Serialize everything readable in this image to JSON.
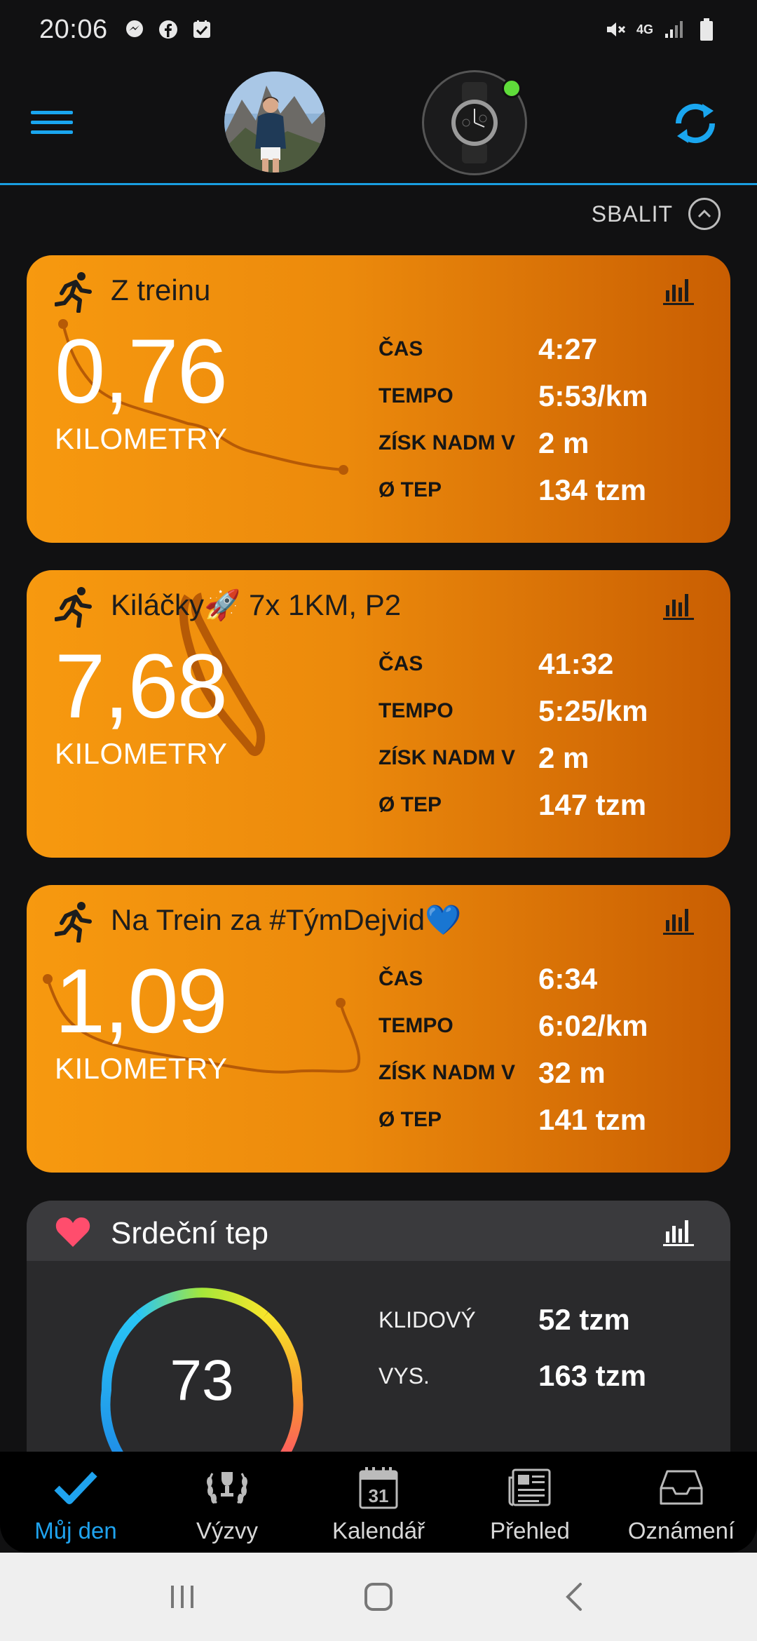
{
  "status_bar": {
    "time": "20:06",
    "notification_icons": [
      "messenger-icon",
      "facebook-icon",
      "task-check-icon"
    ],
    "network": "4G"
  },
  "header": {
    "menu_icon": "hamburger-menu-icon",
    "sync_icon": "sync-icon",
    "device_connected": true,
    "accent_color": "#1a9ee0"
  },
  "collapse": {
    "label": "SBALIT"
  },
  "activities": [
    {
      "title": "Z treinu",
      "distance": "0,76",
      "unit": "KILOMETRY",
      "stats": [
        {
          "label": "ČAS",
          "value": "4:27"
        },
        {
          "label": "TEMPO",
          "value": "5:53/km"
        },
        {
          "label": "ZÍSK NADM V",
          "value": "2 m"
        },
        {
          "label": "Ø TEP",
          "value": "134 tzm"
        }
      ]
    },
    {
      "title": "Kiláčky🚀 7x 1KM, P2",
      "distance": "7,68",
      "unit": "KILOMETRY",
      "stats": [
        {
          "label": "ČAS",
          "value": "41:32"
        },
        {
          "label": "TEMPO",
          "value": "5:25/km"
        },
        {
          "label": "ZÍSK NADM V",
          "value": "2 m"
        },
        {
          "label": "Ø TEP",
          "value": "147 tzm"
        }
      ]
    },
    {
      "title": "Na Trein za #TýmDejvid💙",
      "distance": "1,09",
      "unit": "KILOMETRY",
      "stats": [
        {
          "label": "ČAS",
          "value": "6:34"
        },
        {
          "label": "TEMPO",
          "value": "6:02/km"
        },
        {
          "label": "ZÍSK NADM V",
          "value": "32 m"
        },
        {
          "label": "Ø TEP",
          "value": "141 tzm"
        }
      ]
    }
  ],
  "heart_rate": {
    "title": "Srdeční tep",
    "current": "73",
    "stats": [
      {
        "label": "KLIDOVÝ",
        "value": "52 tzm"
      },
      {
        "label": "VYS.",
        "value": "163 tzm"
      }
    ]
  },
  "bottom_nav": [
    {
      "label": "Můj den",
      "icon": "checkmark-icon",
      "active": true
    },
    {
      "label": "Výzvy",
      "icon": "laurel-icon",
      "active": false
    },
    {
      "label": "Kalendář",
      "icon": "calendar-icon",
      "active": false
    },
    {
      "label": "Přehled",
      "icon": "newsfeed-icon",
      "active": false
    },
    {
      "label": "Oznámení",
      "icon": "inbox-icon",
      "active": false
    }
  ],
  "calendar_day": "31",
  "colors": {
    "card_orange_start": "#f7990f",
    "card_orange_end": "#c95e02",
    "active_nav": "#1fa3ef",
    "heart": "#ff4d6d"
  }
}
